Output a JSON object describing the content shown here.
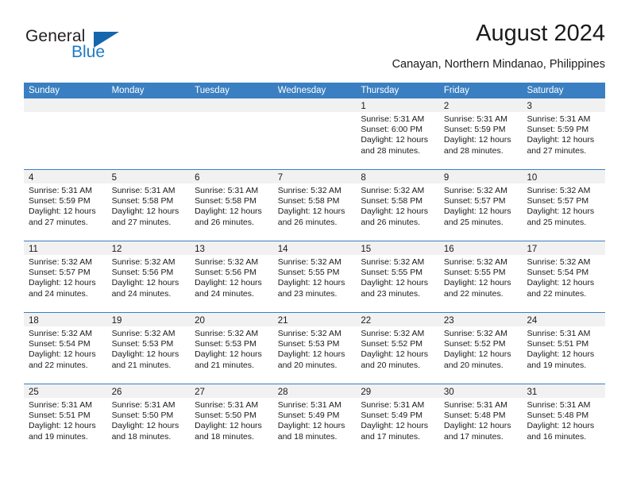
{
  "brand": {
    "name_top": "General",
    "name_bottom": "Blue",
    "triangle_icon": "blue-triangle-icon",
    "color_dark": "#231f20",
    "color_blue": "#1f7ac4"
  },
  "header": {
    "title": "August 2024",
    "subtitle": "Canayan, Northern Mindanao, Philippines"
  },
  "theme": {
    "header_bg": "#3a7fc1",
    "day_strip_bg": "#f1f1f1",
    "text": "#1a1a1a"
  },
  "calendar": {
    "weekdays": [
      "Sunday",
      "Monday",
      "Tuesday",
      "Wednesday",
      "Thursday",
      "Friday",
      "Saturday"
    ],
    "weeks": [
      [
        {
          "day": "",
          "sunrise": "",
          "sunset": "",
          "daylight1": "",
          "daylight2": ""
        },
        {
          "day": "",
          "sunrise": "",
          "sunset": "",
          "daylight1": "",
          "daylight2": ""
        },
        {
          "day": "",
          "sunrise": "",
          "sunset": "",
          "daylight1": "",
          "daylight2": ""
        },
        {
          "day": "",
          "sunrise": "",
          "sunset": "",
          "daylight1": "",
          "daylight2": ""
        },
        {
          "day": "1",
          "sunrise": "Sunrise: 5:31 AM",
          "sunset": "Sunset: 6:00 PM",
          "daylight1": "Daylight: 12 hours",
          "daylight2": "and 28 minutes."
        },
        {
          "day": "2",
          "sunrise": "Sunrise: 5:31 AM",
          "sunset": "Sunset: 5:59 PM",
          "daylight1": "Daylight: 12 hours",
          "daylight2": "and 28 minutes."
        },
        {
          "day": "3",
          "sunrise": "Sunrise: 5:31 AM",
          "sunset": "Sunset: 5:59 PM",
          "daylight1": "Daylight: 12 hours",
          "daylight2": "and 27 minutes."
        }
      ],
      [
        {
          "day": "4",
          "sunrise": "Sunrise: 5:31 AM",
          "sunset": "Sunset: 5:59 PM",
          "daylight1": "Daylight: 12 hours",
          "daylight2": "and 27 minutes."
        },
        {
          "day": "5",
          "sunrise": "Sunrise: 5:31 AM",
          "sunset": "Sunset: 5:58 PM",
          "daylight1": "Daylight: 12 hours",
          "daylight2": "and 27 minutes."
        },
        {
          "day": "6",
          "sunrise": "Sunrise: 5:31 AM",
          "sunset": "Sunset: 5:58 PM",
          "daylight1": "Daylight: 12 hours",
          "daylight2": "and 26 minutes."
        },
        {
          "day": "7",
          "sunrise": "Sunrise: 5:32 AM",
          "sunset": "Sunset: 5:58 PM",
          "daylight1": "Daylight: 12 hours",
          "daylight2": "and 26 minutes."
        },
        {
          "day": "8",
          "sunrise": "Sunrise: 5:32 AM",
          "sunset": "Sunset: 5:58 PM",
          "daylight1": "Daylight: 12 hours",
          "daylight2": "and 26 minutes."
        },
        {
          "day": "9",
          "sunrise": "Sunrise: 5:32 AM",
          "sunset": "Sunset: 5:57 PM",
          "daylight1": "Daylight: 12 hours",
          "daylight2": "and 25 minutes."
        },
        {
          "day": "10",
          "sunrise": "Sunrise: 5:32 AM",
          "sunset": "Sunset: 5:57 PM",
          "daylight1": "Daylight: 12 hours",
          "daylight2": "and 25 minutes."
        }
      ],
      [
        {
          "day": "11",
          "sunrise": "Sunrise: 5:32 AM",
          "sunset": "Sunset: 5:57 PM",
          "daylight1": "Daylight: 12 hours",
          "daylight2": "and 24 minutes."
        },
        {
          "day": "12",
          "sunrise": "Sunrise: 5:32 AM",
          "sunset": "Sunset: 5:56 PM",
          "daylight1": "Daylight: 12 hours",
          "daylight2": "and 24 minutes."
        },
        {
          "day": "13",
          "sunrise": "Sunrise: 5:32 AM",
          "sunset": "Sunset: 5:56 PM",
          "daylight1": "Daylight: 12 hours",
          "daylight2": "and 24 minutes."
        },
        {
          "day": "14",
          "sunrise": "Sunrise: 5:32 AM",
          "sunset": "Sunset: 5:55 PM",
          "daylight1": "Daylight: 12 hours",
          "daylight2": "and 23 minutes."
        },
        {
          "day": "15",
          "sunrise": "Sunrise: 5:32 AM",
          "sunset": "Sunset: 5:55 PM",
          "daylight1": "Daylight: 12 hours",
          "daylight2": "and 23 minutes."
        },
        {
          "day": "16",
          "sunrise": "Sunrise: 5:32 AM",
          "sunset": "Sunset: 5:55 PM",
          "daylight1": "Daylight: 12 hours",
          "daylight2": "and 22 minutes."
        },
        {
          "day": "17",
          "sunrise": "Sunrise: 5:32 AM",
          "sunset": "Sunset: 5:54 PM",
          "daylight1": "Daylight: 12 hours",
          "daylight2": "and 22 minutes."
        }
      ],
      [
        {
          "day": "18",
          "sunrise": "Sunrise: 5:32 AM",
          "sunset": "Sunset: 5:54 PM",
          "daylight1": "Daylight: 12 hours",
          "daylight2": "and 22 minutes."
        },
        {
          "day": "19",
          "sunrise": "Sunrise: 5:32 AM",
          "sunset": "Sunset: 5:53 PM",
          "daylight1": "Daylight: 12 hours",
          "daylight2": "and 21 minutes."
        },
        {
          "day": "20",
          "sunrise": "Sunrise: 5:32 AM",
          "sunset": "Sunset: 5:53 PM",
          "daylight1": "Daylight: 12 hours",
          "daylight2": "and 21 minutes."
        },
        {
          "day": "21",
          "sunrise": "Sunrise: 5:32 AM",
          "sunset": "Sunset: 5:53 PM",
          "daylight1": "Daylight: 12 hours",
          "daylight2": "and 20 minutes."
        },
        {
          "day": "22",
          "sunrise": "Sunrise: 5:32 AM",
          "sunset": "Sunset: 5:52 PM",
          "daylight1": "Daylight: 12 hours",
          "daylight2": "and 20 minutes."
        },
        {
          "day": "23",
          "sunrise": "Sunrise: 5:32 AM",
          "sunset": "Sunset: 5:52 PM",
          "daylight1": "Daylight: 12 hours",
          "daylight2": "and 20 minutes."
        },
        {
          "day": "24",
          "sunrise": "Sunrise: 5:31 AM",
          "sunset": "Sunset: 5:51 PM",
          "daylight1": "Daylight: 12 hours",
          "daylight2": "and 19 minutes."
        }
      ],
      [
        {
          "day": "25",
          "sunrise": "Sunrise: 5:31 AM",
          "sunset": "Sunset: 5:51 PM",
          "daylight1": "Daylight: 12 hours",
          "daylight2": "and 19 minutes."
        },
        {
          "day": "26",
          "sunrise": "Sunrise: 5:31 AM",
          "sunset": "Sunset: 5:50 PM",
          "daylight1": "Daylight: 12 hours",
          "daylight2": "and 18 minutes."
        },
        {
          "day": "27",
          "sunrise": "Sunrise: 5:31 AM",
          "sunset": "Sunset: 5:50 PM",
          "daylight1": "Daylight: 12 hours",
          "daylight2": "and 18 minutes."
        },
        {
          "day": "28",
          "sunrise": "Sunrise: 5:31 AM",
          "sunset": "Sunset: 5:49 PM",
          "daylight1": "Daylight: 12 hours",
          "daylight2": "and 18 minutes."
        },
        {
          "day": "29",
          "sunrise": "Sunrise: 5:31 AM",
          "sunset": "Sunset: 5:49 PM",
          "daylight1": "Daylight: 12 hours",
          "daylight2": "and 17 minutes."
        },
        {
          "day": "30",
          "sunrise": "Sunrise: 5:31 AM",
          "sunset": "Sunset: 5:48 PM",
          "daylight1": "Daylight: 12 hours",
          "daylight2": "and 17 minutes."
        },
        {
          "day": "31",
          "sunrise": "Sunrise: 5:31 AM",
          "sunset": "Sunset: 5:48 PM",
          "daylight1": "Daylight: 12 hours",
          "daylight2": "and 16 minutes."
        }
      ]
    ]
  }
}
